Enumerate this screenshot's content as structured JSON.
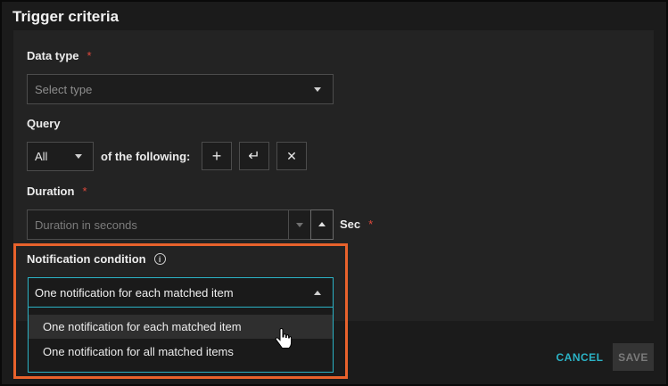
{
  "dialog": {
    "title": "Trigger criteria"
  },
  "data_type": {
    "label": "Data type",
    "required_mark": "*",
    "placeholder": "Select type"
  },
  "query": {
    "label": "Query",
    "scope_value": "All",
    "of_following_text": "of the following:",
    "add_icon": "+",
    "enter_icon": "↵",
    "remove_icon": "✕"
  },
  "duration": {
    "label": "Duration",
    "required_mark": "*",
    "placeholder": "Duration in seconds",
    "unit_label": "Sec",
    "unit_required_mark": "*"
  },
  "notification": {
    "label": "Notification condition",
    "info_icon": "info-circle",
    "selected_value": "One notification for each matched item",
    "options": [
      "One notification for each matched item",
      "One notification for all matched items"
    ]
  },
  "footer": {
    "cancel_label": "CANCEL",
    "save_label": "SAVE"
  },
  "colors": {
    "accent": "#2bb3c6",
    "required": "#e0493c",
    "highlight": "#e8622c"
  }
}
